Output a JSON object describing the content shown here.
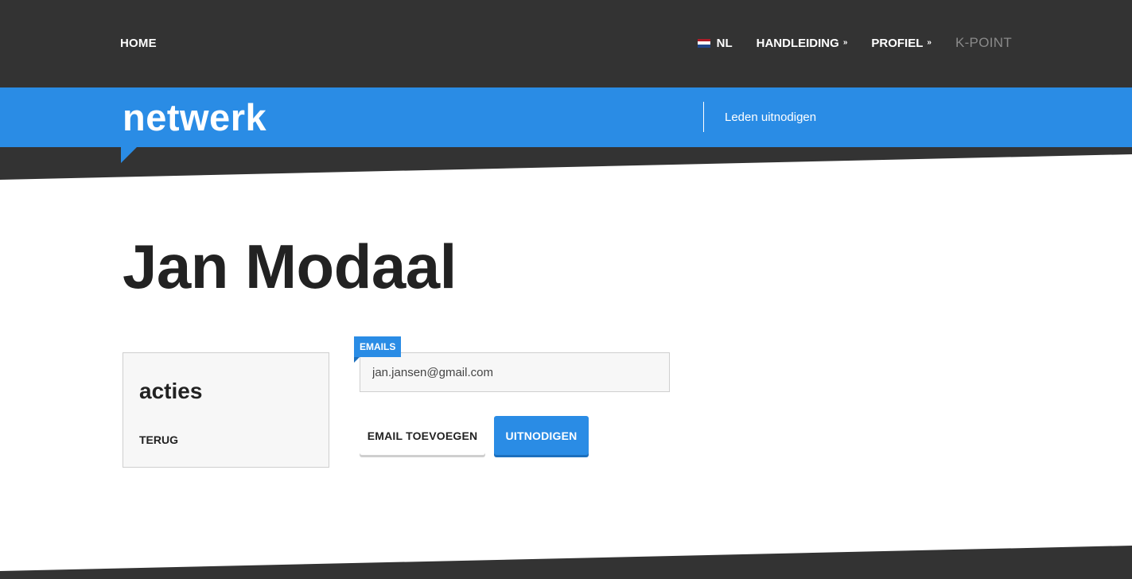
{
  "nav": {
    "home": "HOME",
    "language": "NL",
    "manual": "HANDLEIDING",
    "profile": "PROFIEL",
    "brand": "K-POINT"
  },
  "banner": {
    "title": "netwerk",
    "link": "Leden uitnodigen"
  },
  "page": {
    "title": "Jan Modaal"
  },
  "actions": {
    "title": "acties",
    "back_label": "TERUG"
  },
  "form": {
    "emails_tag": "EMAILS",
    "email_value": "jan.jansen@gmail.com",
    "add_email_label": "EMAIL TOEVOEGEN",
    "invite_label": "UITNODIGEN"
  },
  "icons": {
    "flag": "netherlands-flag-icon",
    "dropdown": "double-chevron-down-icon"
  },
  "colors": {
    "accent": "#2a8ce5",
    "dark": "#333333",
    "panel_bg": "#f7f7f7"
  }
}
